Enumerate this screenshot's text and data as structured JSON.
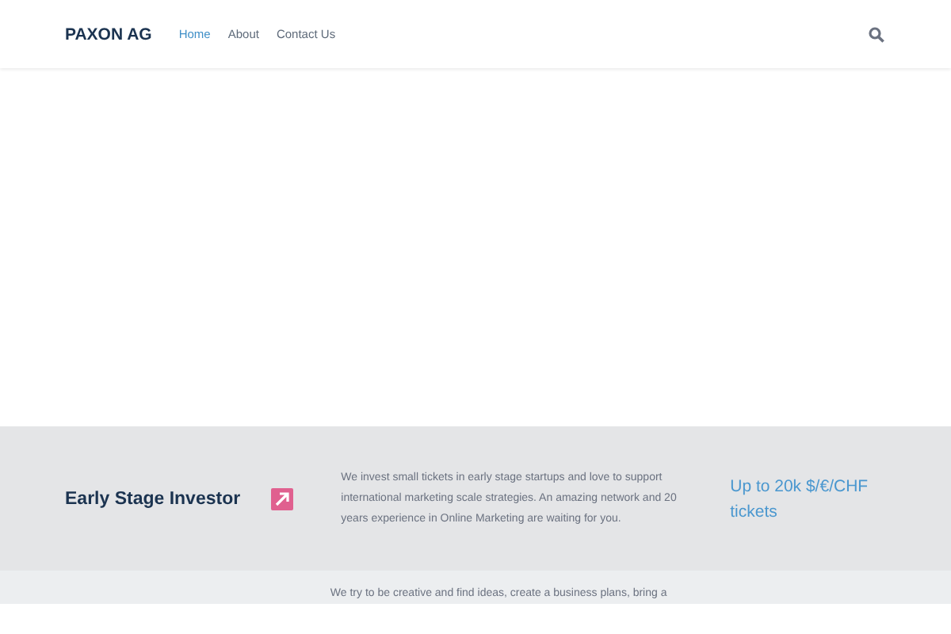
{
  "header": {
    "logo": "PAXON AG",
    "nav": [
      {
        "label": "Home",
        "selected": true
      },
      {
        "label": "About",
        "selected": false
      },
      {
        "label": "Contact Us",
        "selected": false
      }
    ]
  },
  "sections": [
    {
      "title": "Early Stage Investor",
      "text": "We invest small tickets in early stage startups and love to support international marketing scale strategies. An amazing network and 20 years experience in Online Marketing are waiting for you.",
      "highlight": "Up to 20k $/€/CHF tickets"
    },
    {
      "text": "We try to be creative and find ideas, create a business plans, bring a"
    }
  ]
}
